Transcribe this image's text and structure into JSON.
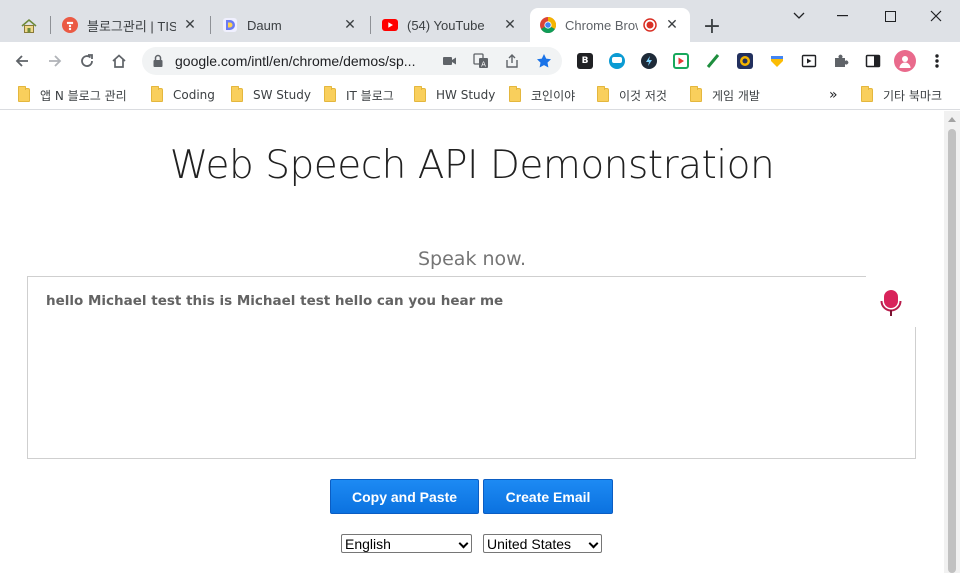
{
  "browser": {
    "tabs": [
      {
        "title": "블로그관리 | TIST",
        "icon": "tistory-icon",
        "active": false
      },
      {
        "title": "Daum",
        "icon": "daum-icon",
        "active": false
      },
      {
        "title": "(54) YouTube",
        "icon": "youtube-icon",
        "active": false
      },
      {
        "title": "Chrome Brow",
        "icon": "chrome-icon",
        "active": true
      }
    ],
    "new_tab_label": "+",
    "window_controls": [
      "chevron-down-icon",
      "minimize-icon",
      "maximize-icon",
      "close-icon"
    ],
    "url": "google.com/intl/en/chrome/demos/sp...",
    "bookmarks": [
      {
        "label": "앱 N 블로그 관리"
      },
      {
        "label": "Coding"
      },
      {
        "label": "SW Study"
      },
      {
        "label": "IT 블로그"
      },
      {
        "label": "HW Study"
      },
      {
        "label": "코인이야"
      },
      {
        "label": "이것 저것"
      },
      {
        "label": "게임 개발"
      }
    ],
    "bookmarks_overflow": "»",
    "other_bookmarks": "기타 북마크"
  },
  "page": {
    "title_part1": "Web Speech API",
    "title_part2": "Demonstration",
    "info": "Speak now.",
    "transcript": "hello Michael test this is Michael test hello can you hear me",
    "buttons": {
      "copy": "Copy and Paste",
      "email": "Create Email"
    },
    "language": "English",
    "dialect": "United States"
  },
  "colors": {
    "button_blue": "#1a73e8",
    "mic_red": "#d8235a",
    "youtube_red": "#ff0000"
  }
}
